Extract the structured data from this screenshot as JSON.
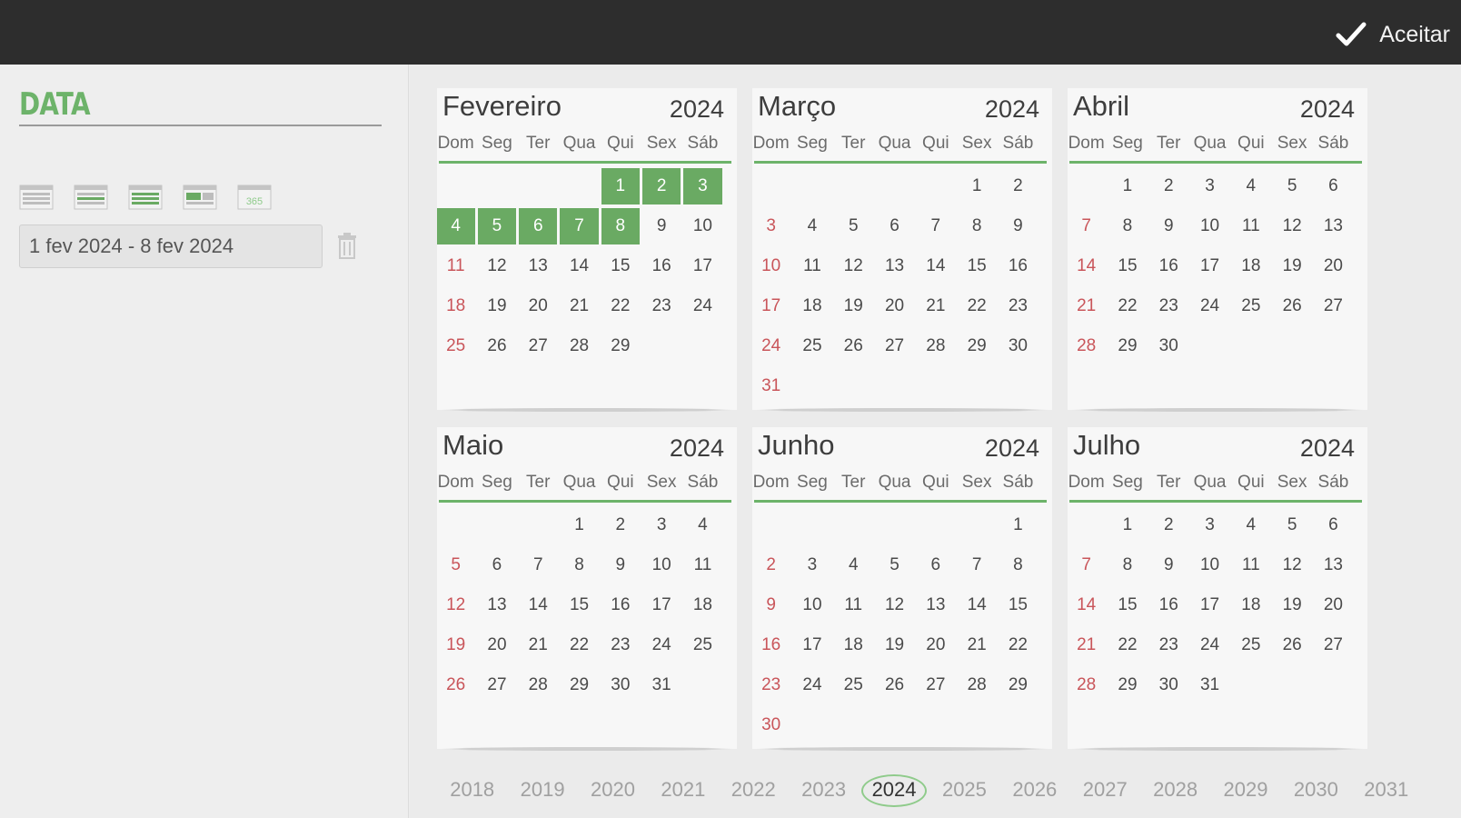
{
  "header": {
    "accept_label": "Aceitar"
  },
  "panel": {
    "title": "DATA",
    "range_value": "1 fev 2024 - 8 fev 2024",
    "icon_365": "365",
    "icons": [
      "day-calendar-icon",
      "week-calendar-icon",
      "month-calendar-icon",
      "custom-calendar-icon",
      "year-calendar-icon"
    ]
  },
  "weekdays": [
    "Dom",
    "Seg",
    "Ter",
    "Qua",
    "Qui",
    "Sex",
    "Sáb"
  ],
  "months": [
    {
      "name": "Fevereiro",
      "year": "2024",
      "offset": 4,
      "days": 29,
      "selected": [
        1,
        2,
        3,
        4,
        5,
        6,
        7,
        8
      ]
    },
    {
      "name": "Março",
      "year": "2024",
      "offset": 5,
      "days": 31,
      "selected": []
    },
    {
      "name": "Abril",
      "year": "2024",
      "offset": 1,
      "days": 30,
      "selected": []
    },
    {
      "name": "Maio",
      "year": "2024",
      "offset": 3,
      "days": 31,
      "selected": []
    },
    {
      "name": "Junho",
      "year": "2024",
      "offset": 6,
      "days": 30,
      "selected": []
    },
    {
      "name": "Julho",
      "year": "2024",
      "offset": 1,
      "days": 31,
      "selected": []
    }
  ],
  "years": [
    "2018",
    "2019",
    "2020",
    "2021",
    "2022",
    "2023",
    "2024",
    "2025",
    "2026",
    "2027",
    "2028",
    "2029",
    "2030",
    "2031"
  ],
  "current_year": "2024",
  "colors": {
    "accent": "#6aaa63",
    "sunday": "#c9555a",
    "topbar": "#2d2d2d"
  }
}
